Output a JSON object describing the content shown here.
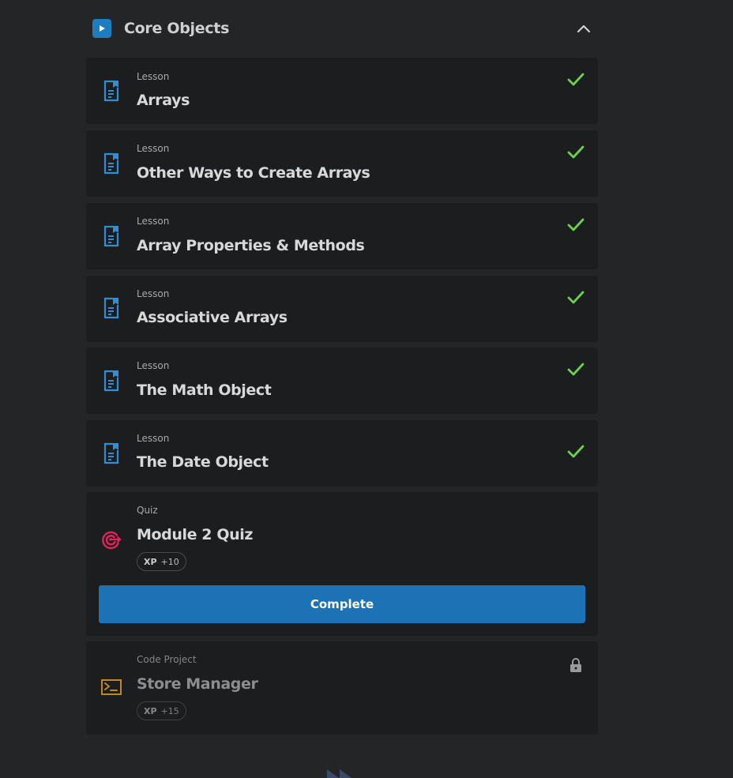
{
  "module": {
    "title": "Core Objects",
    "icon": "play-icon",
    "collapse_icon": "chevron-up-icon"
  },
  "items": [
    {
      "type": "Lesson",
      "title": "Arrays",
      "icon": "lesson-document-icon",
      "status": "completed"
    },
    {
      "type": "Lesson",
      "title": "Other Ways to Create Arrays",
      "icon": "lesson-document-icon",
      "status": "completed"
    },
    {
      "type": "Lesson",
      "title": "Array Properties & Methods",
      "icon": "lesson-document-icon",
      "status": "completed"
    },
    {
      "type": "Lesson",
      "title": "Associative Arrays",
      "icon": "lesson-document-icon",
      "status": "completed"
    },
    {
      "type": "Lesson",
      "title": "The Math Object",
      "icon": "lesson-document-icon",
      "status": "completed"
    },
    {
      "type": "Lesson",
      "title": "The Date Object",
      "icon": "lesson-document-icon",
      "status": "completed"
    }
  ],
  "quiz": {
    "type": "Quiz",
    "title": "Module 2 Quiz",
    "icon": "target-icon",
    "xp_label": "XP",
    "xp_value": "+10",
    "button_label": "Complete"
  },
  "project": {
    "type": "Code Project",
    "title": "Store Manager",
    "icon": "terminal-icon",
    "xp_label": "XP",
    "xp_value": "+15",
    "status": "locked"
  },
  "colors": {
    "background": "#242526",
    "card": "#1c1d1f",
    "accent_blue": "#1e7dc0",
    "check_green": "#6bd24a",
    "quiz_icon": "#e0245e",
    "project_icon": "#c7861b",
    "button": "#1c72b4"
  }
}
